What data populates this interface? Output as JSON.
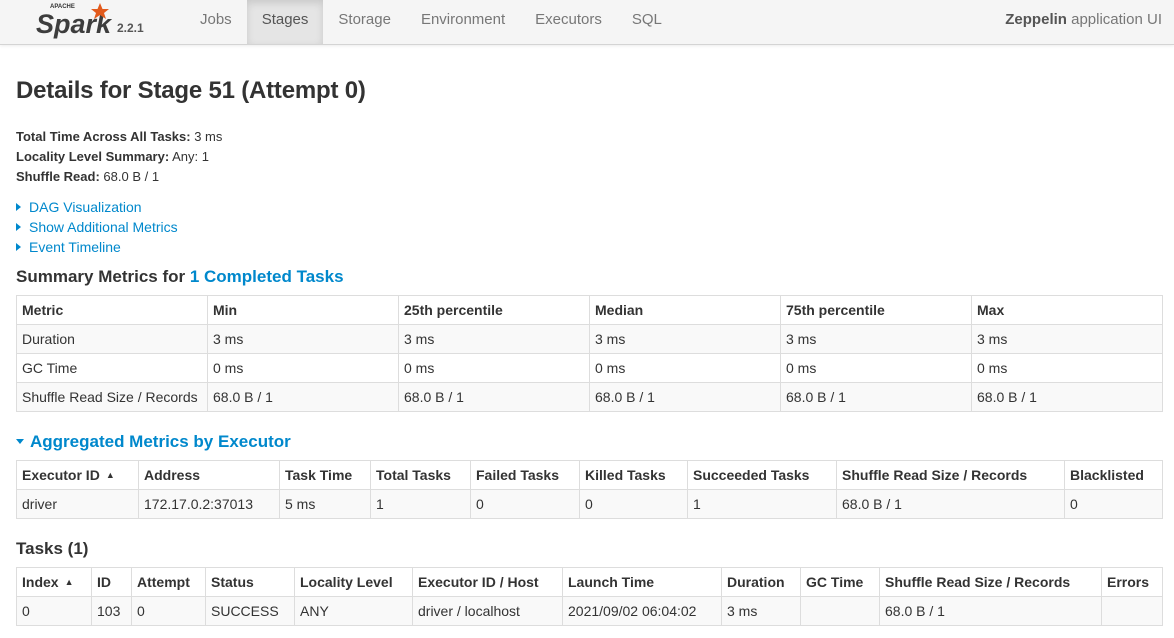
{
  "navbar": {
    "logo_small": "APACHE",
    "logo_text": "Spark",
    "version": "2.2.1",
    "tabs": [
      {
        "label": "Jobs",
        "active": false
      },
      {
        "label": "Stages",
        "active": true
      },
      {
        "label": "Storage",
        "active": false
      },
      {
        "label": "Environment",
        "active": false
      },
      {
        "label": "Executors",
        "active": false
      },
      {
        "label": "SQL",
        "active": false
      }
    ],
    "app_name": "Zeppelin",
    "app_suffix": " application UI"
  },
  "page": {
    "title": "Details for Stage 51 (Attempt 0)",
    "summary": [
      {
        "label": "Total Time Across All Tasks:",
        "value": " 3 ms"
      },
      {
        "label": "Locality Level Summary:",
        "value": " Any: 1"
      },
      {
        "label": "Shuffle Read:",
        "value": " 68.0 B / 1"
      }
    ],
    "links": [
      "DAG Visualization",
      "Show Additional Metrics",
      "Event Timeline"
    ]
  },
  "summary_metrics": {
    "title_prefix": "Summary Metrics for ",
    "title_link": "1 Completed Tasks",
    "headers": [
      "Metric",
      "Min",
      "25th percentile",
      "Median",
      "75th percentile",
      "Max"
    ],
    "rows": [
      [
        "Duration",
        "3 ms",
        "3 ms",
        "3 ms",
        "3 ms",
        "3 ms"
      ],
      [
        "GC Time",
        "0 ms",
        "0 ms",
        "0 ms",
        "0 ms",
        "0 ms"
      ],
      [
        "Shuffle Read Size / Records",
        "68.0 B / 1",
        "68.0 B / 1",
        "68.0 B / 1",
        "68.0 B / 1",
        "68.0 B / 1"
      ]
    ]
  },
  "aggregated": {
    "title": "Aggregated Metrics by Executor",
    "headers": [
      "Executor ID",
      "Address",
      "Task Time",
      "Total Tasks",
      "Failed Tasks",
      "Killed Tasks",
      "Succeeded Tasks",
      "Shuffle Read Size / Records",
      "Blacklisted"
    ],
    "sort_indicator": "▲",
    "rows": [
      [
        "driver",
        "172.17.0.2:37013",
        "5 ms",
        "1",
        "0",
        "0",
        "1",
        "68.0 B / 1",
        "0"
      ]
    ]
  },
  "tasks": {
    "title": "Tasks (1)",
    "headers": [
      "Index",
      "ID",
      "Attempt",
      "Status",
      "Locality Level",
      "Executor ID / Host",
      "Launch Time",
      "Duration",
      "GC Time",
      "Shuffle Read Size / Records",
      "Errors"
    ],
    "sort_indicator": "▲",
    "rows": [
      [
        "0",
        "103",
        "0",
        "SUCCESS",
        "ANY",
        "driver / localhost",
        "2021/09/02 06:04:02",
        "3 ms",
        "",
        "68.0 B / 1",
        ""
      ]
    ]
  }
}
